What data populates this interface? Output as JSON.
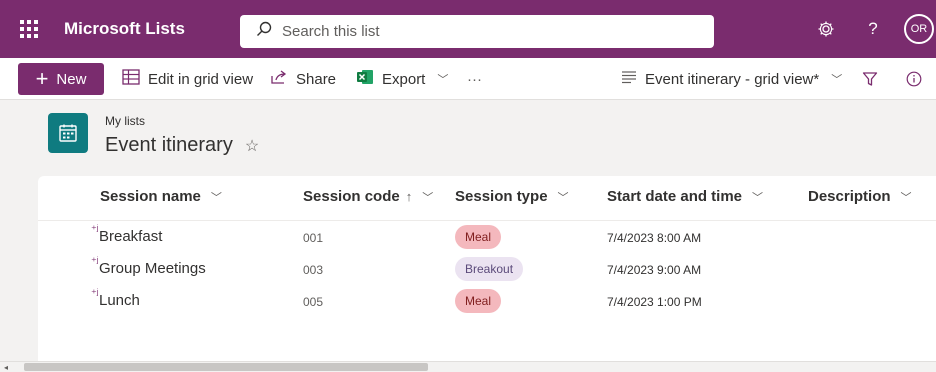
{
  "header": {
    "app_title": "Microsoft Lists",
    "search_placeholder": "Search this list",
    "help_label": "?",
    "avatar_initials": "OR"
  },
  "command_bar": {
    "new_label": "New",
    "edit_grid_label": "Edit in grid view",
    "share_label": "Share",
    "export_label": "Export",
    "more_label": "···",
    "view_label": "Event itinerary - grid view*"
  },
  "list": {
    "breadcrumb": "My lists",
    "title": "Event itinerary"
  },
  "table": {
    "columns": [
      {
        "label": "Session name"
      },
      {
        "label": "Session code",
        "sort": "↑"
      },
      {
        "label": "Session type"
      },
      {
        "label": "Start date and time"
      },
      {
        "label": "Description"
      }
    ],
    "rows": [
      {
        "name": "Breakfast",
        "code": "001",
        "type": "Meal",
        "start": "7/4/2023 8:00 AM"
      },
      {
        "name": "Group Meetings",
        "code": "003",
        "type": "Breakout",
        "start": "7/4/2023 9:00 AM"
      },
      {
        "name": "Lunch",
        "code": "005",
        "type": "Meal",
        "start": "7/4/2023 1:00 PM"
      }
    ]
  },
  "colors": {
    "brand": "#7a2c6e",
    "list_icon": "#0f7b80",
    "meal_pill": "#f4b8bd",
    "breakout_pill": "#ebe3f1"
  },
  "icons": {
    "app_launcher": "waffle-icon",
    "search": "search-icon",
    "settings": "gear-icon",
    "help": "help-icon",
    "edit_grid": "grid-icon",
    "share": "share-icon",
    "export": "excel-icon",
    "view": "view-lines-icon",
    "filter": "filter-icon",
    "info": "info-icon",
    "favorite": "star-icon"
  }
}
